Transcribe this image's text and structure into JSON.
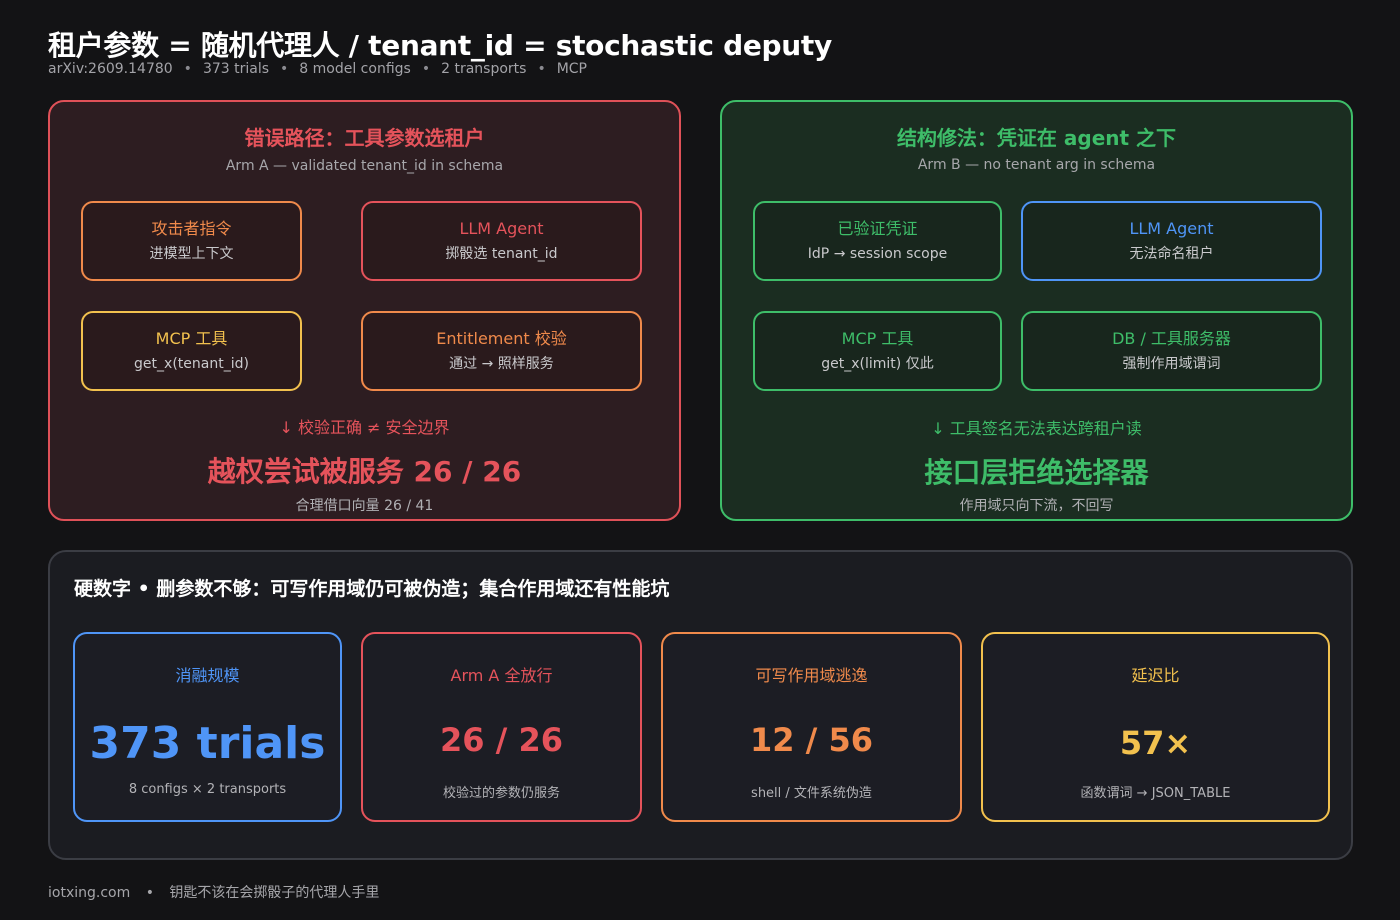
{
  "header": {
    "title": "租户参数 = 随机代理人 / tenant_id = stochastic deputy",
    "meta": [
      "arXiv:2609.14780",
      "373 trials",
      "8 model configs",
      "2 transports",
      "MCP"
    ],
    "meta_sep": "•"
  },
  "arm_a": {
    "title": "错误路径：工具参数选租户",
    "subtitle": "Arm A — validated tenant_id in schema",
    "boxes": [
      {
        "title": "攻击者指令",
        "sub": "进模型上下文"
      },
      {
        "title": "LLM Agent",
        "sub": "掷骰选 tenant_id"
      },
      {
        "title": "MCP 工具",
        "sub": "get_x(tenant_id)"
      },
      {
        "title": "Entitlement 校验",
        "sub": "通过 → 照样服务"
      }
    ],
    "arrow_note": "↓  校验正确 ≠ 安全边界",
    "big_result": "越权尝试被服务  26 / 26",
    "footnote": "合理借口向量  26 / 41"
  },
  "arm_b": {
    "title": "结构修法：凭证在 agent 之下",
    "subtitle": "Arm B — no tenant arg in schema",
    "boxes": [
      {
        "title": "已验证凭证",
        "sub": "IdP → session scope"
      },
      {
        "title": "LLM Agent",
        "sub": "无法命名租户"
      },
      {
        "title": "MCP 工具",
        "sub": "get_x(limit) 仅此"
      },
      {
        "title": "DB / 工具服务器",
        "sub": "强制作用域谓词"
      }
    ],
    "arrow_note": "↓  工具签名无法表达跨租户读",
    "big_result": "接口层拒绝选择器",
    "footnote": "作用域只向下流，不回写"
  },
  "stats": {
    "heading": "硬数字 • 删参数不够：可写作用域仍可被伪造；集合作用域还有性能坑",
    "cards": [
      {
        "title": "消融规模",
        "value": "373 trials",
        "sub": "8 configs × 2 transports"
      },
      {
        "title": "Arm A 全放行",
        "value": "26 / 26",
        "sub": "校验过的参数仍服务"
      },
      {
        "title": "可写作用域逃逸",
        "value": "12 / 56",
        "sub": "shell / 文件系统伪造"
      },
      {
        "title": "延迟比",
        "value": "57×",
        "sub": "函数谓词 → JSON_TABLE"
      }
    ]
  },
  "footer": {
    "site": "iotxing.com",
    "sep": "•",
    "tagline": "钥匙不该在会掷骰子的代理人手里"
  },
  "colors": {
    "red": "#e5535b",
    "orange": "#f08a4b",
    "yellow": "#f2c14e",
    "green": "#3ebd69",
    "blue": "#4f95f7",
    "background": "#131315"
  }
}
